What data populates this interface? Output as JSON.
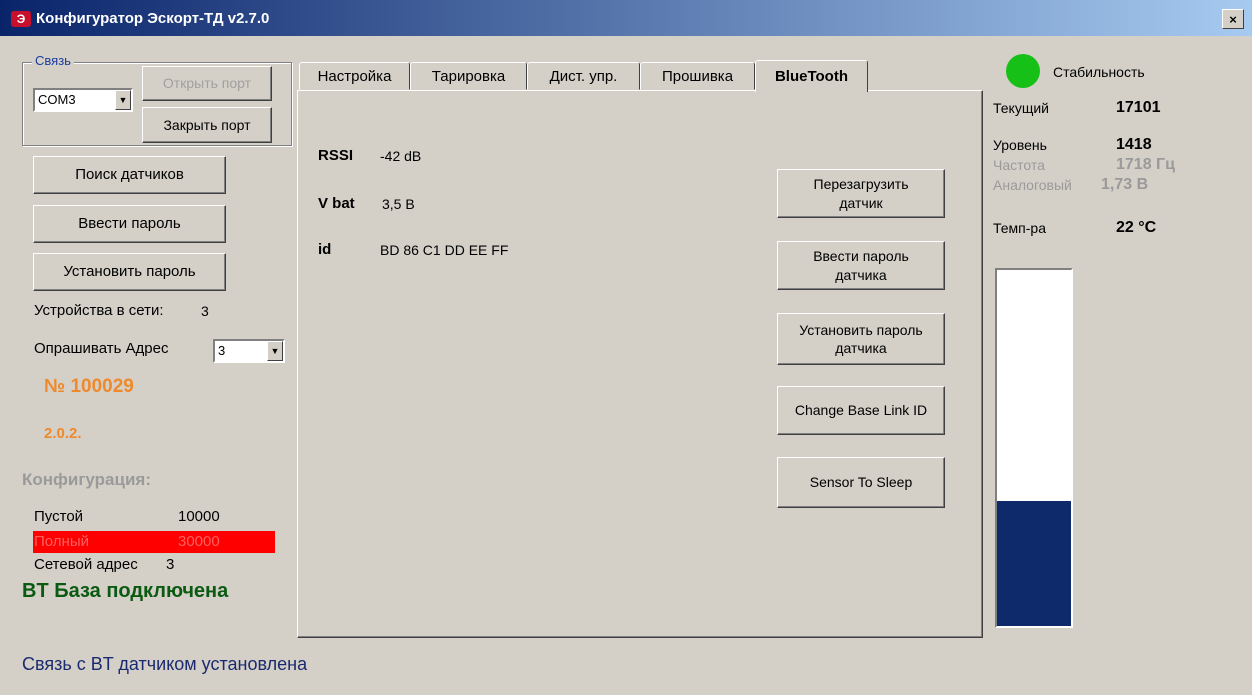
{
  "window": {
    "title": "Конфигуратор Эскорт-ТД v2.7.0",
    "close": "×",
    "icon_letter": "Э"
  },
  "connection": {
    "legend": "Связь",
    "port_value": "COM3",
    "open_label": "Открыть порт",
    "close_label": "Закрыть порт"
  },
  "actions": {
    "search_label": "Поиск датчиков",
    "enter_password_label": "Ввести пароль",
    "set_password_label": "Установить пароль"
  },
  "devices": {
    "label": "Устройства в сети:",
    "count": "3"
  },
  "poll": {
    "label": "Опрашивать Адрес",
    "value": "3"
  },
  "device_info": {
    "number": "№ 100029",
    "version": "2.0.2."
  },
  "config": {
    "title": "Конфигурация:",
    "empty_label": "Пустой",
    "empty_value": "10000",
    "full_label": "Полный",
    "full_value": "30000",
    "addr_label": "Сетевой адрес",
    "addr_value": "3",
    "bt_status": "BT База подключена"
  },
  "status_bar": "Связь с BT датчиком установлена",
  "tabs": [
    {
      "label": "Настройка"
    },
    {
      "label": "Тарировка"
    },
    {
      "label": "Дист. упр."
    },
    {
      "label": "Прошивка"
    },
    {
      "label": "BlueTooth",
      "active": true
    }
  ],
  "bluetooth": {
    "rssi_label": "RSSI",
    "rssi_value": "-42 dB",
    "vbat_label": "V bat",
    "vbat_value": "3,5 В",
    "id_label": "id",
    "id_value": "BD 86 C1 DD EE FF",
    "buttons": {
      "reboot_line1": "Перезагрузить",
      "reboot_line2": "датчик",
      "enter_pw_line1": "Ввести пароль",
      "enter_pw_line2": "датчика",
      "set_pw_line1": "Установить пароль",
      "set_pw_line2": "датчика",
      "change_id": "Change Base Link ID",
      "sleep": "Sensor To Sleep"
    }
  },
  "readings": {
    "stability_label": "Стабильность",
    "stability_color": "#16c016",
    "current_label": "Текущий",
    "current_value": "17101",
    "level_label": "Уровень",
    "level_value": "1418",
    "freq_label": "Частота",
    "freq_value": "1718 Гц",
    "analog_label": "Аналоговый",
    "analog_value": "1,73 В",
    "temp_label": "Темп-ра",
    "temp_value": "22 °C"
  },
  "gauge": {
    "fill_fraction": 0.35,
    "fill_color": "#0e2a6b"
  }
}
